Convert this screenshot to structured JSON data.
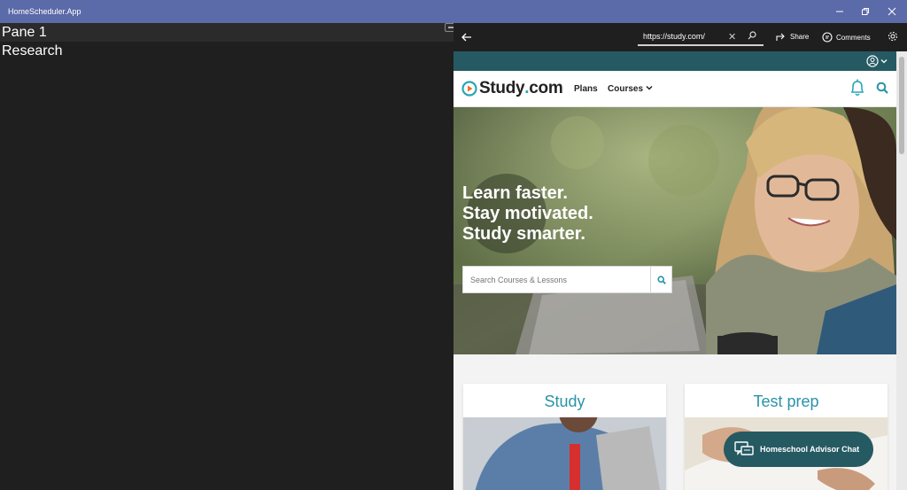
{
  "window": {
    "title": "HomeScheduler.App"
  },
  "left_pane": {
    "header": "Pane 1",
    "section": "Research"
  },
  "browser": {
    "url": "https://study.com/",
    "share_label": "Share",
    "comments_label": "Comments"
  },
  "site": {
    "logo_main": "Study",
    "logo_dot": ".",
    "logo_tld": "com",
    "nav": {
      "plans": "Plans",
      "courses": "Courses"
    },
    "hero": {
      "line1": "Learn faster.",
      "line2": "Stay motivated.",
      "line3": "Study smarter.",
      "search_placeholder": "Search Courses & Lessons"
    },
    "cards": [
      {
        "title": "Study"
      },
      {
        "title": "Test prep"
      }
    ],
    "chat_label": "Homeschool Advisor Chat"
  },
  "colors": {
    "titlebar": "#5b6aa8",
    "site_teal": "#265a63",
    "accent": "#2a93a8",
    "pane_bg": "#1f1f1f"
  }
}
